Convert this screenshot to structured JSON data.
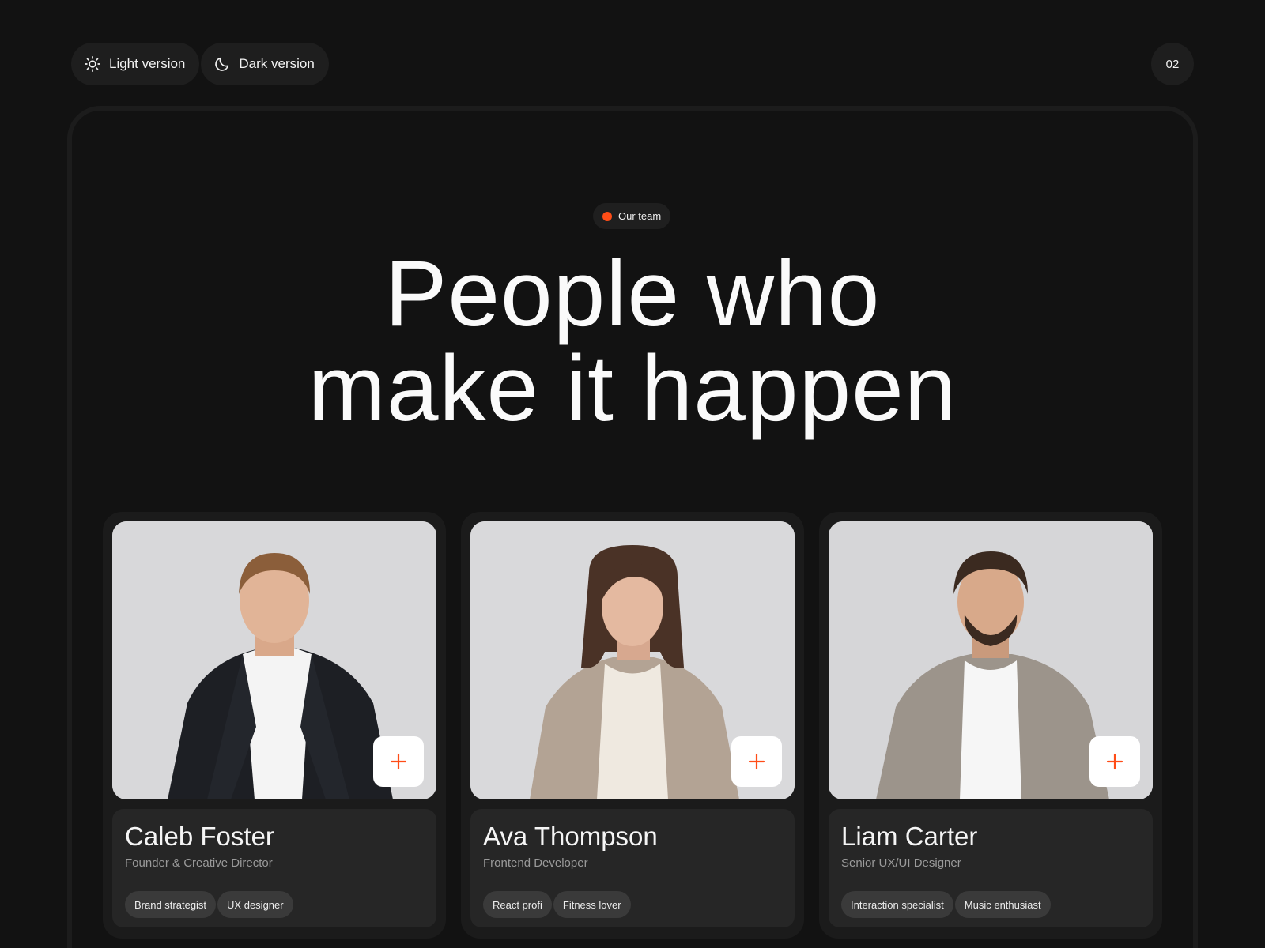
{
  "topbar": {
    "light_label": "Light version",
    "dark_label": "Dark version",
    "page_number": "02"
  },
  "section": {
    "tag": "Our team",
    "headline_line1": "People who",
    "headline_line2": "make it happen"
  },
  "team": [
    {
      "name": "Caleb Foster",
      "role": "Founder & Creative Director",
      "tags": [
        "Brand strategist",
        "UX designer"
      ],
      "icon": "plus-icon"
    },
    {
      "name": "Ava Thompson",
      "role": "Frontend Developer",
      "tags": [
        "React profi",
        "Fitness lover"
      ],
      "icon": "plus-icon"
    },
    {
      "name": "Liam Carter",
      "role": "Senior UX/UI Designer",
      "tags": [
        "Interaction specialist",
        "Music enthusiast"
      ],
      "icon": "plus-icon"
    }
  ],
  "colors": {
    "background": "#121212",
    "accent": "#ff4d17",
    "card": "#1b1b1b",
    "info_panel": "#262626",
    "chip": "#3a3a3a"
  }
}
